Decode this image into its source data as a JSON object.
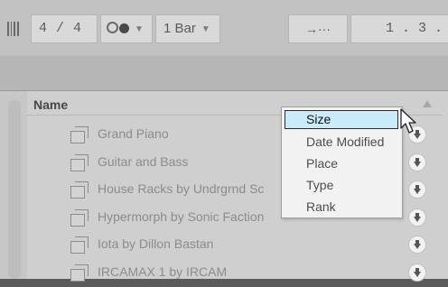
{
  "transport": {
    "time_signature": "4 / 4",
    "metronome_caret": "▼",
    "quantization": "1 Bar",
    "quantization_caret": "▼",
    "follow_symbol": "→···",
    "position": "1 . 3 ."
  },
  "browser": {
    "column_header": "Name",
    "items": [
      {
        "label": "Grand Piano"
      },
      {
        "label": "Guitar and Bass"
      },
      {
        "label": "House Racks by Undrgrnd Sc"
      },
      {
        "label": "Hypermorph by Sonic Faction"
      },
      {
        "label": "Iota by Dillon Bastan"
      },
      {
        "label": "IRCAMAX 1 by IRCAM"
      }
    ]
  },
  "sort_menu": {
    "items": [
      "Size",
      "Date Modified",
      "Place",
      "Type",
      "Rank"
    ],
    "highlighted": "Size"
  },
  "colors": {
    "highlight": "#c9ecfb",
    "transport_bg": "#c2c2c2"
  }
}
